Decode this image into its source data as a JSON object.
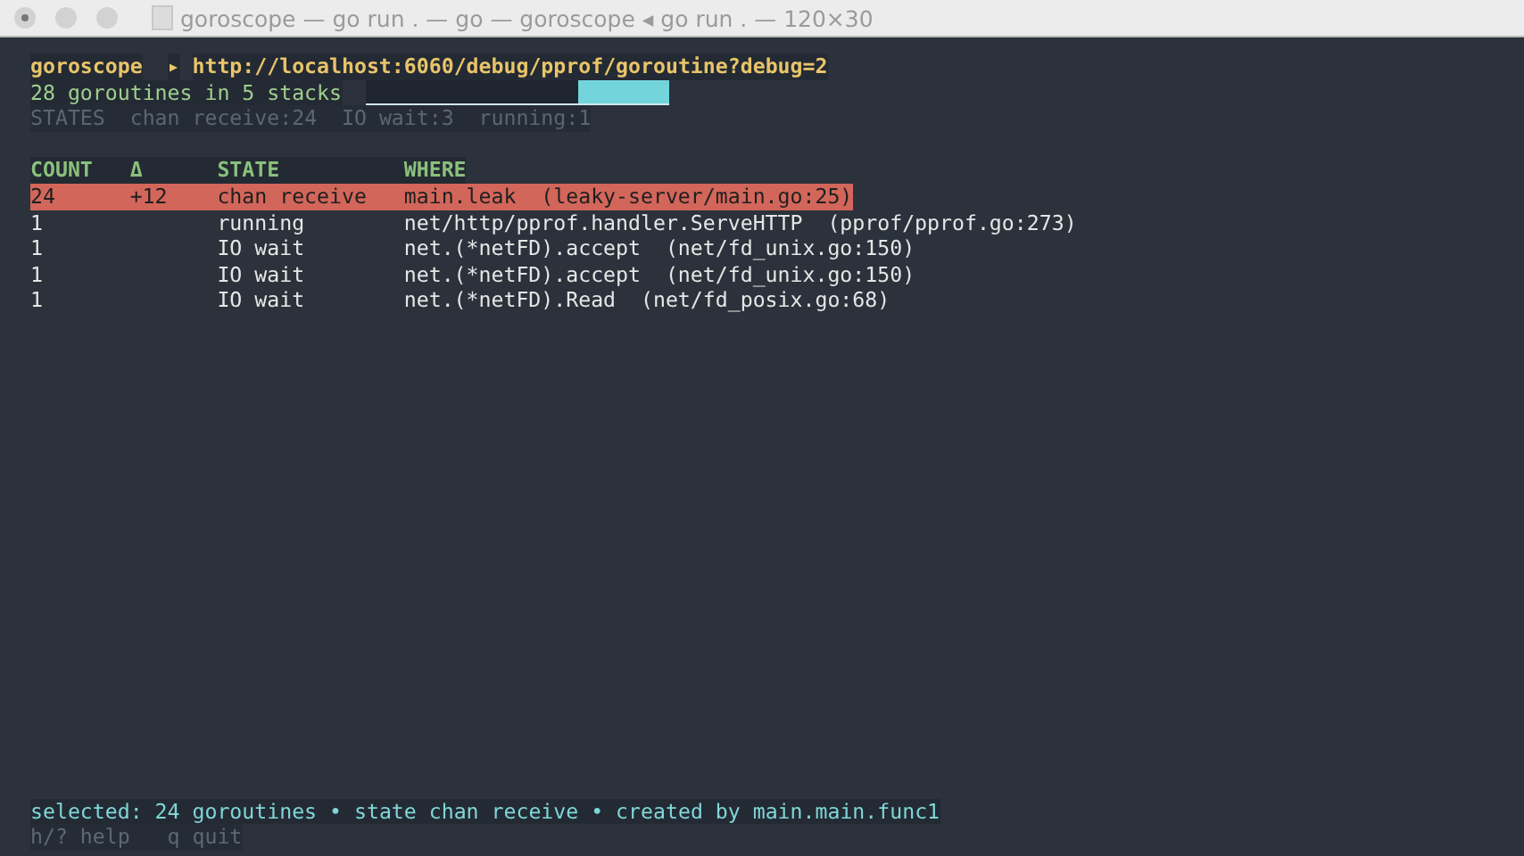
{
  "window": {
    "title": "goroscope — go run . — go — goroscope ◂ go run . — 120×30"
  },
  "header": {
    "app": "goroscope",
    "arrow": "▸",
    "url": "http://localhost:6060/debug/pprof/goroutine?debug=2"
  },
  "summary": {
    "text": "28 goroutines in 5 stacks",
    "bar": {
      "level": 0.3
    }
  },
  "states": [
    "STATES",
    "chan receive:24",
    "IO wait:3",
    "running:1"
  ],
  "table": {
    "columns": [
      "COUNT",
      "Δ",
      "STATE",
      "WHERE"
    ],
    "rows": [
      {
        "count": "24",
        "delta": "+12",
        "state": "chan receive",
        "where": "main.leak  (leaky-server/main.go:25)",
        "selected": true
      },
      {
        "count": "1",
        "delta": "",
        "state": "running",
        "where": "net/http/pprof.handler.ServeHTTP  (pprof/pprof.go:273)",
        "selected": false
      },
      {
        "count": "1",
        "delta": "",
        "state": "IO wait",
        "where": "net.(*netFD).accept  (net/fd_unix.go:150)",
        "selected": false
      },
      {
        "count": "1",
        "delta": "",
        "state": "IO wait",
        "where": "net.(*netFD).accept  (net/fd_unix.go:150)",
        "selected": false
      },
      {
        "count": "1",
        "delta": "",
        "state": "IO wait",
        "where": "net.(*netFD).Read  (net/fd_posix.go:68)",
        "selected": false
      }
    ]
  },
  "status": "selected: 24 goroutines • state chan receive • created by main.main.func1",
  "help": "h/? help   q quit"
}
